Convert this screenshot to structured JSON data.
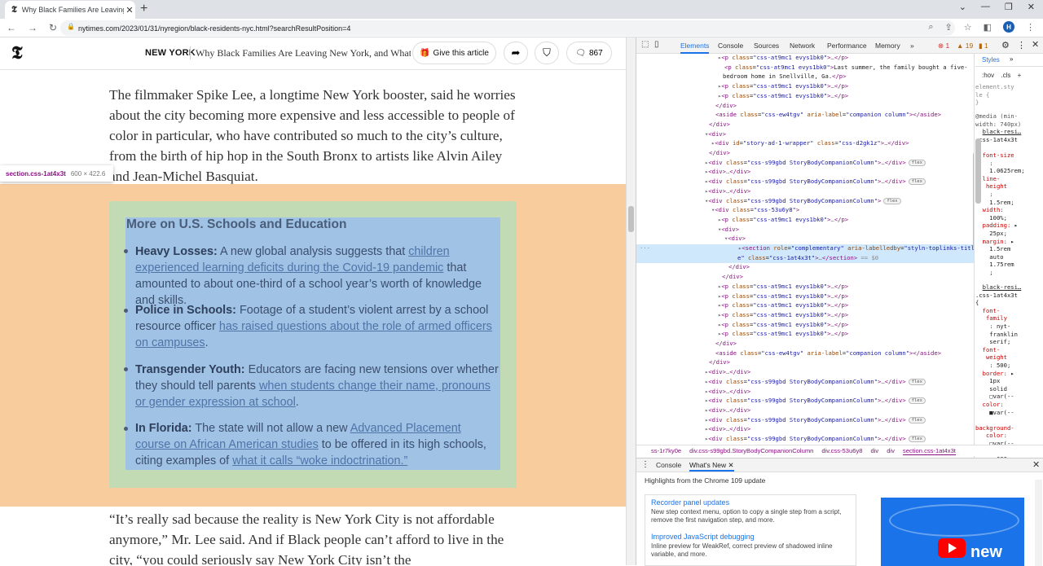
{
  "browser": {
    "tab_title": "Why Black Families Are Leaving N",
    "url": "nytimes.com/2023/01/31/nyregion/black-residents-nyc.html?searchResultPosition=4",
    "profile_initial": "H"
  },
  "nyt": {
    "section": "NEW YORK",
    "headline": "Why Black Families Are Leaving New York, and What",
    "give_label": "Give this article",
    "comment_count": "867"
  },
  "article": {
    "para1": "The filmmaker Spike Lee, a longtime New York booster, said he worries about the city becoming more expensive and less accessible to people of color in particular, who have contributed so much to the city’s culture, from the birth of hip hop in the South Bronx to artists like Alvin Ailey and Jean-Michel Basquiat.",
    "para2": "“It’s really sad because the reality is New York City is not affordable anymore,” Mr. Lee said. And if Black people can’t afford to live in the city, “you could seriously say New York City isn’t the",
    "related": {
      "title": "More on U.S. Schools and Education",
      "items": [
        {
          "bold": "Heavy Losses:",
          "pre": "A new global analysis suggests that",
          "link": "children experienced learning deficits during the Covid-19 pandemic",
          "post": "that amounted to about one-third of a school year’s worth of knowledge and skills."
        },
        {
          "bold": "Police in Schools:",
          "pre": "Footage of a student’s violent arrest by a school resource officer",
          "link": "has raised questions about the role of armed officers on campuses",
          "post": "."
        },
        {
          "bold": "Transgender Youth:",
          "pre": "Educators are facing new tensions over whether they should tell parents",
          "link": "when students change their name, pronouns or gender expression at school",
          "post": "."
        },
        {
          "bold": "In Florida:",
          "pre": "The state will not allow a new",
          "link": "Advanced Placement course on African American studies",
          "post": "to be offered in its high schools, citing examples of",
          "link2": "what it calls “woke indoctrination.”"
        }
      ]
    }
  },
  "inspector_tooltip": {
    "selector": "section.css-1at4x3t",
    "size": "600 × 422.6"
  },
  "devtools": {
    "tabs": [
      "Elements",
      "Console",
      "Sources",
      "Network",
      "Performance",
      "Memory"
    ],
    "errors": "1",
    "warnings": "19",
    "infos": "1",
    "styles_tab": "Styles",
    "filter_hov": ":hov",
    "filter_cls": ".cls",
    "breadcrumb": [
      "ss-1r7ky0e",
      "div.css-s99gbd.StoryBodyCompanionColumn",
      "div.css-53u6y8",
      "div",
      "div",
      "section.css-1at4x3t"
    ],
    "drawer_console": "Console",
    "drawer_whatsnew": "What's New",
    "highlights": "Highlights from the Chrome 109 update",
    "whatsnew": [
      {
        "title": "Recorder panel updates",
        "desc": "New step context menu, option to copy a single step from a script, remove the first navigation step, and more."
      },
      {
        "title": "Improved JavaScript debugging",
        "desc": "Inline preview for WeakRef, correct preview of shadowed inline variable, and more."
      }
    ],
    "video_word": "new"
  }
}
